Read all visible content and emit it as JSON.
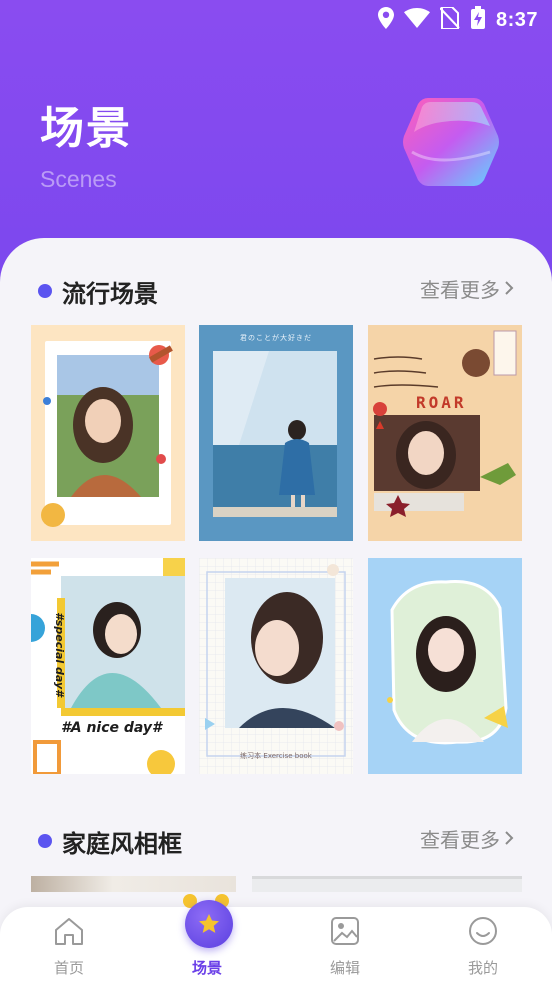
{
  "status_bar": {
    "time": "8:37"
  },
  "header": {
    "title": "场景",
    "subtitle": "Scenes"
  },
  "sections": [
    {
      "title": "流行场景",
      "more_label": "查看更多"
    },
    {
      "title": "家庭风相框",
      "more_label": "查看更多"
    }
  ],
  "popular_scenes": [
    {
      "overlay_text": ""
    },
    {
      "overlay_text": "君のことが大好きだ"
    },
    {
      "overlay_text": "ROAR"
    },
    {
      "overlay_text": "#A nice day#",
      "side_text": "#special day#"
    },
    {
      "overlay_text": "练习本 Exercise book"
    },
    {
      "overlay_text": ""
    }
  ],
  "tabbar": {
    "items": [
      {
        "label": "首页",
        "icon": "home-icon"
      },
      {
        "label": "场景",
        "icon": "star-icon"
      },
      {
        "label": "编辑",
        "icon": "image-edit-icon"
      },
      {
        "label": "我的",
        "icon": "profile-smile-icon"
      }
    ],
    "active_index": 1
  },
  "colors": {
    "accent": "#6a3fe8",
    "header": "#8a4cf0",
    "dot": "#5b54f0"
  }
}
